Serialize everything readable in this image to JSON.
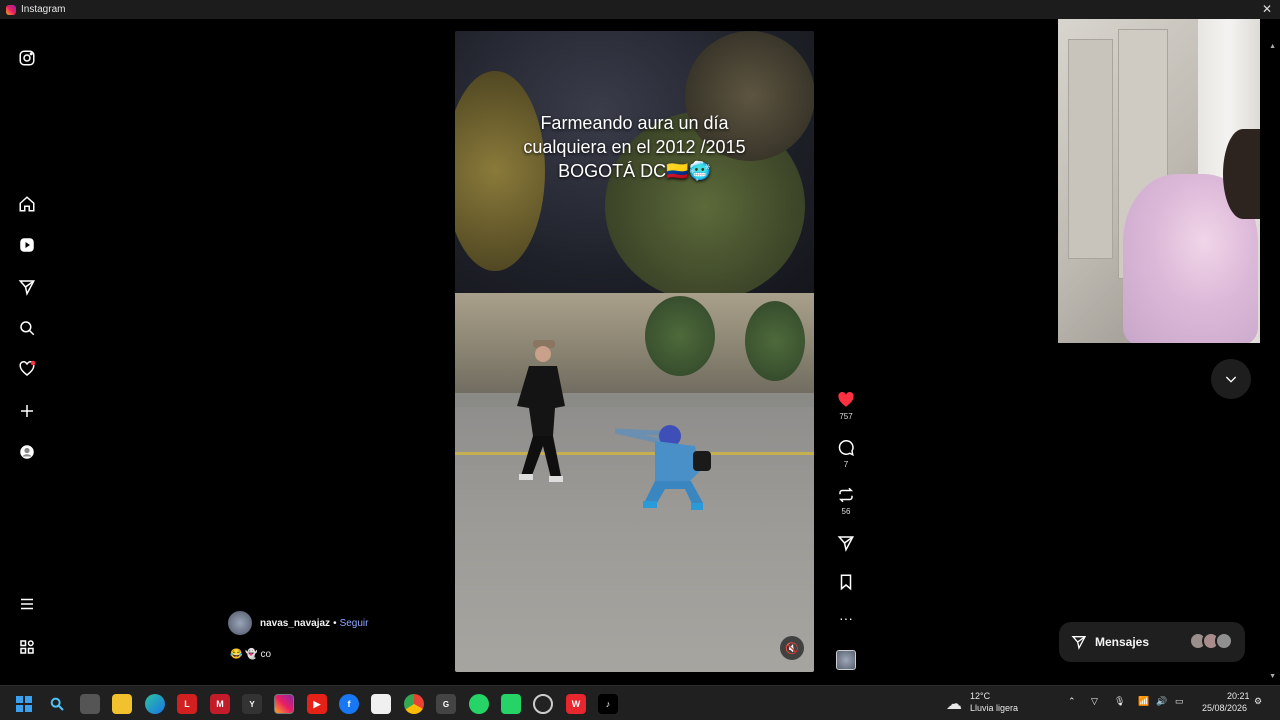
{
  "window": {
    "title": "Instagram"
  },
  "sidebar": {
    "items": [
      "instagram-logo",
      "home",
      "reels",
      "send",
      "search",
      "notifications",
      "create",
      "profile",
      "menu",
      "more"
    ]
  },
  "reel": {
    "caption_line1": "Farmeando aura un día",
    "caption_line2": "cualquiera en el 2012 /2015",
    "caption_line3": "BOGOTÁ DC🇨🇴🥶",
    "author": "navas_navajaz",
    "separator": "•",
    "follow_label": "Seguir",
    "description": "😂 👻 co",
    "mute_icon": "🔇"
  },
  "actions": {
    "likes": "757",
    "comments": "7",
    "reposts": "56"
  },
  "messages": {
    "label": "Mensajes"
  },
  "taskbar": {
    "weather_temp": "12°C",
    "weather_desc": "Lluvia ligera",
    "time": "20:21",
    "date": "25/08/2026"
  },
  "colors": {
    "like": "#ff3040",
    "accent_link": "#8fa9ff",
    "bg": "#000000"
  }
}
